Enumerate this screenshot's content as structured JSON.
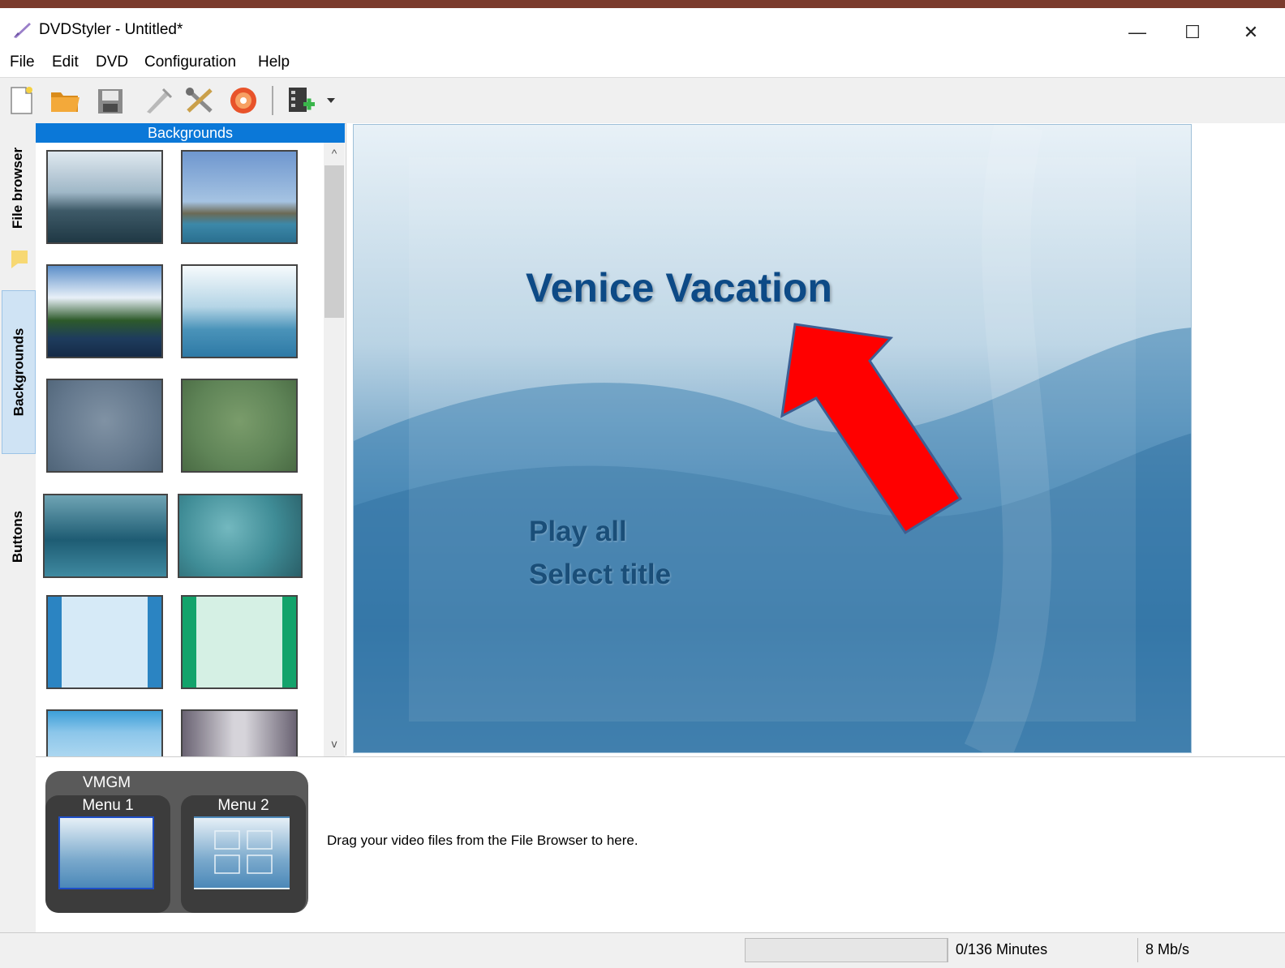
{
  "window": {
    "title": "DVDStyler - Untitled*",
    "minimize_glyph": "—",
    "maximize_glyph": "☐",
    "close_glyph": "✕"
  },
  "menubar": {
    "items": [
      "File",
      "Edit",
      "DVD",
      "Configuration",
      "Help"
    ]
  },
  "toolbar": {
    "icons": [
      "new-project-icon",
      "open-folder-icon",
      "save-icon",
      "wizard-icon",
      "settings-icon",
      "burn-icon",
      "add-video-icon",
      "dropdown-arrow-icon"
    ]
  },
  "side_tabs": [
    "File browser",
    "Backgrounds",
    "Buttons"
  ],
  "panel": {
    "header": "Backgrounds",
    "scroll_up": "^",
    "scroll_down": "v"
  },
  "preview": {
    "title": "Venice Vacation",
    "buttons": [
      "Play all",
      "Select title"
    ]
  },
  "titleset": {
    "vmgm_label": "VMGM",
    "menus": [
      "Menu 1",
      "Menu 2"
    ],
    "drag_hint": "Drag your video files from the File Browser to here."
  },
  "statusbar": {
    "minutes": "0/136 Minutes",
    "bitrate": "8 Mb/s"
  },
  "colors": {
    "accent": "#0b78d8",
    "annotation_arrow": "#ff0000"
  }
}
